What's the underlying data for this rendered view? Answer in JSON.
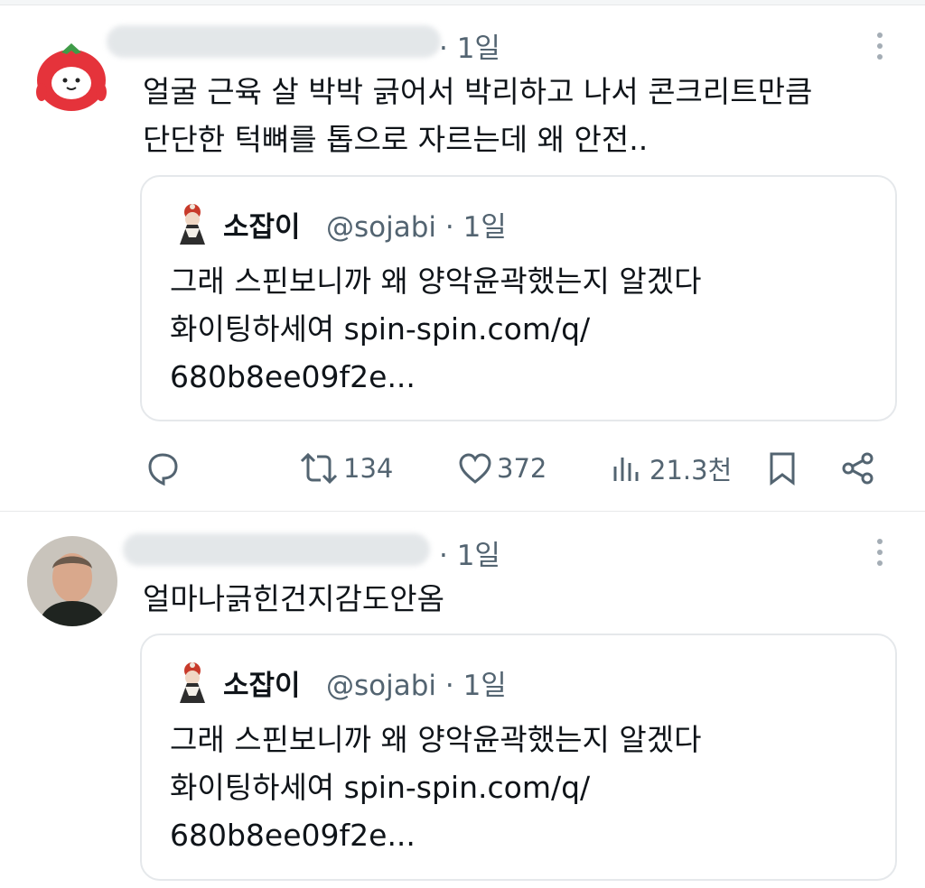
{
  "tweets": [
    {
      "time": "· 1일",
      "text_lines": [
        "얼굴 근육 살 박박 긁어서 박리하고 나서 콘크리트만큼",
        "단단한 턱뼈를 톱으로 자르는데 왜 안전.."
      ],
      "quote": {
        "name": "소잡이",
        "handle": "@sojabi · 1일",
        "lines": [
          "그래  스핀보니까 왜 양악윤곽했는지 알겠다",
          "화이팅하세여  spin-spin.com/q/",
          "680b8ee09f2e..."
        ]
      },
      "actions": {
        "reply_icon": "reply-icon",
        "retweet_count": "134",
        "like_count": "372",
        "view_count": "21.3천"
      }
    },
    {
      "time": "· 1일",
      "text_lines": [
        "얼마나긁힌건지감도안옴"
      ],
      "quote": {
        "name": "소잡이",
        "handle": "@sojabi · 1일",
        "lines": [
          "그래  스핀보니까 왜 양악윤곽했는지 알겠다",
          "화이팅하세여  spin-spin.com/q/",
          "680b8ee09f2e..."
        ]
      }
    }
  ],
  "colors": {
    "text": "#0f1419",
    "muted": "#536471",
    "border": "#e5e8eb",
    "tomato": "#e5333b"
  }
}
